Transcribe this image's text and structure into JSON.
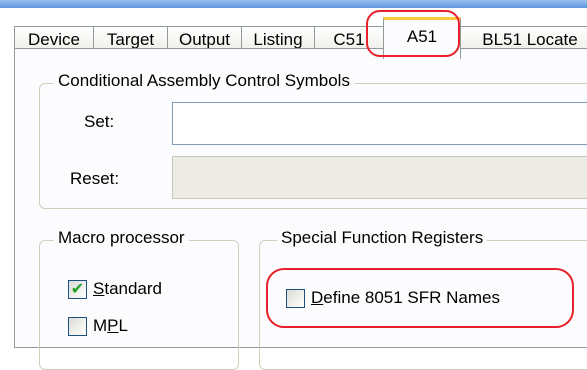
{
  "tabs": [
    {
      "label": "Device",
      "active": false
    },
    {
      "label": "Target",
      "active": false
    },
    {
      "label": "Output",
      "active": false
    },
    {
      "label": "Listing",
      "active": false
    },
    {
      "label": "C51",
      "active": false
    },
    {
      "label": "A51",
      "active": true
    },
    {
      "label": "BL51 Locate",
      "active": false
    }
  ],
  "conditional_assembly": {
    "legend": "Conditional Assembly Control Symbols",
    "set_label": "Set:",
    "set_value": "",
    "reset_label": "Reset:",
    "reset_value": ""
  },
  "macro_processor": {
    "legend": "Macro processor",
    "standard": {
      "label_before": "",
      "mnemonic": "S",
      "label_after": "tandard",
      "checked": true
    },
    "mpl": {
      "label_before": "M",
      "mnemonic": "P",
      "label_after": "L",
      "checked": false
    }
  },
  "sfr": {
    "legend": "Special Function Registers",
    "define_names": {
      "label_before": "",
      "mnemonic": "D",
      "label_after": "efine 8051 SFR Names",
      "checked": false
    }
  },
  "colors": {
    "highlight": "#e8202a",
    "active_tab_accent": "#ffc83c",
    "checkmark": "#21a121"
  },
  "icons": {
    "check": "✔"
  }
}
